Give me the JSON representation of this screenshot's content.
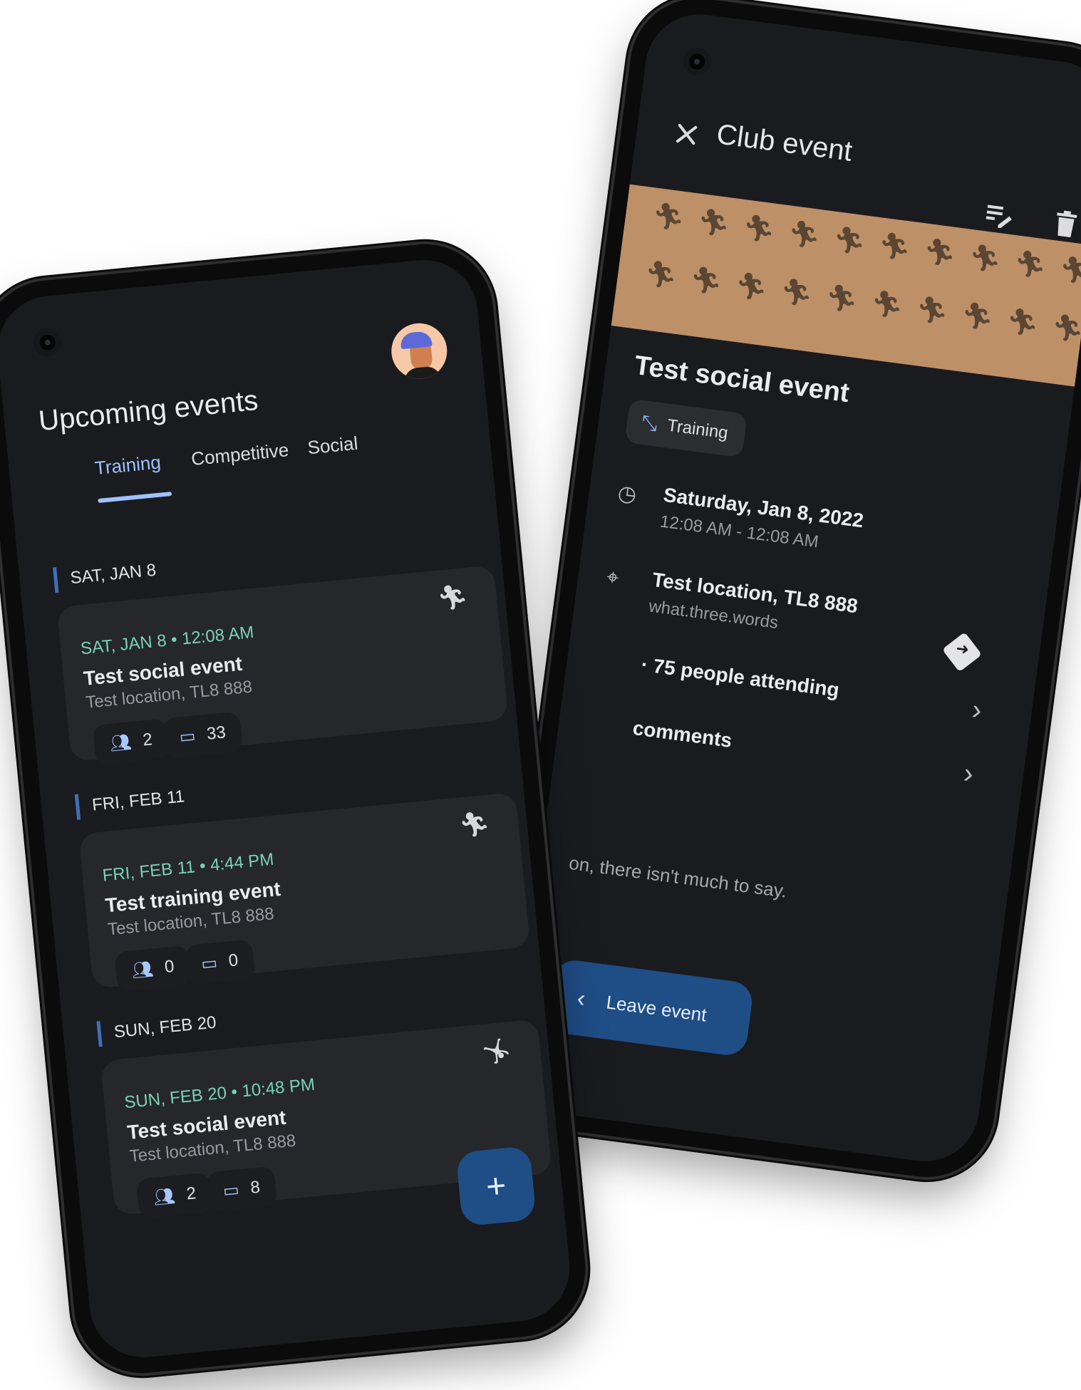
{
  "detail_screen": {
    "app_bar_title": "Club event",
    "event_title": "Test social event",
    "category_chip": "Training",
    "date_main": "Saturday, Jan 8, 2022",
    "time_range": "12:08 AM - 12:08 AM",
    "location_main": "Test location, TL8 888",
    "location_sub": "what.three.words",
    "attending_text": "· 75 people attending",
    "comments_text": "comments",
    "description": "on, there isn't much to say.",
    "leave_button": "Leave event",
    "banner_icon": "directions-run-icon",
    "colors": {
      "banner": "#bd9068",
      "accent": "#1f4d86"
    }
  },
  "list_screen": {
    "page_title": "Upcoming events",
    "tabs": [
      {
        "label": "Training",
        "active": true
      },
      {
        "label": "Competitive",
        "active": false
      },
      {
        "label": "Social",
        "active": false
      }
    ],
    "sections": [
      {
        "header": "SAT, JAN 8",
        "card": {
          "date": "SAT, JAN 8 • 12:08 AM",
          "title": "Test social event",
          "location": "Test location, TL8 888",
          "attendees": "2",
          "comments": "33",
          "icon": "directions-run-icon"
        }
      },
      {
        "header": "FRI, FEB 11",
        "card": {
          "date": "FRI, FEB 11 • 4:44 PM",
          "title": "Test training event",
          "location": "Test location, TL8 888",
          "attendees": "0",
          "comments": "0",
          "icon": "directions-run-icon"
        }
      },
      {
        "header": "SUN, FEB 20",
        "card": {
          "date": "SUN, FEB 20 • 10:48 PM",
          "title": "Test social event",
          "location": "Test location, TL8 888",
          "attendees": "2",
          "comments": "8",
          "icon": "sports-martial-arts-icon"
        }
      }
    ],
    "fab_label": "+",
    "colors": {
      "date": "#79d3b4",
      "active_tab": "#9fc2ff"
    }
  }
}
